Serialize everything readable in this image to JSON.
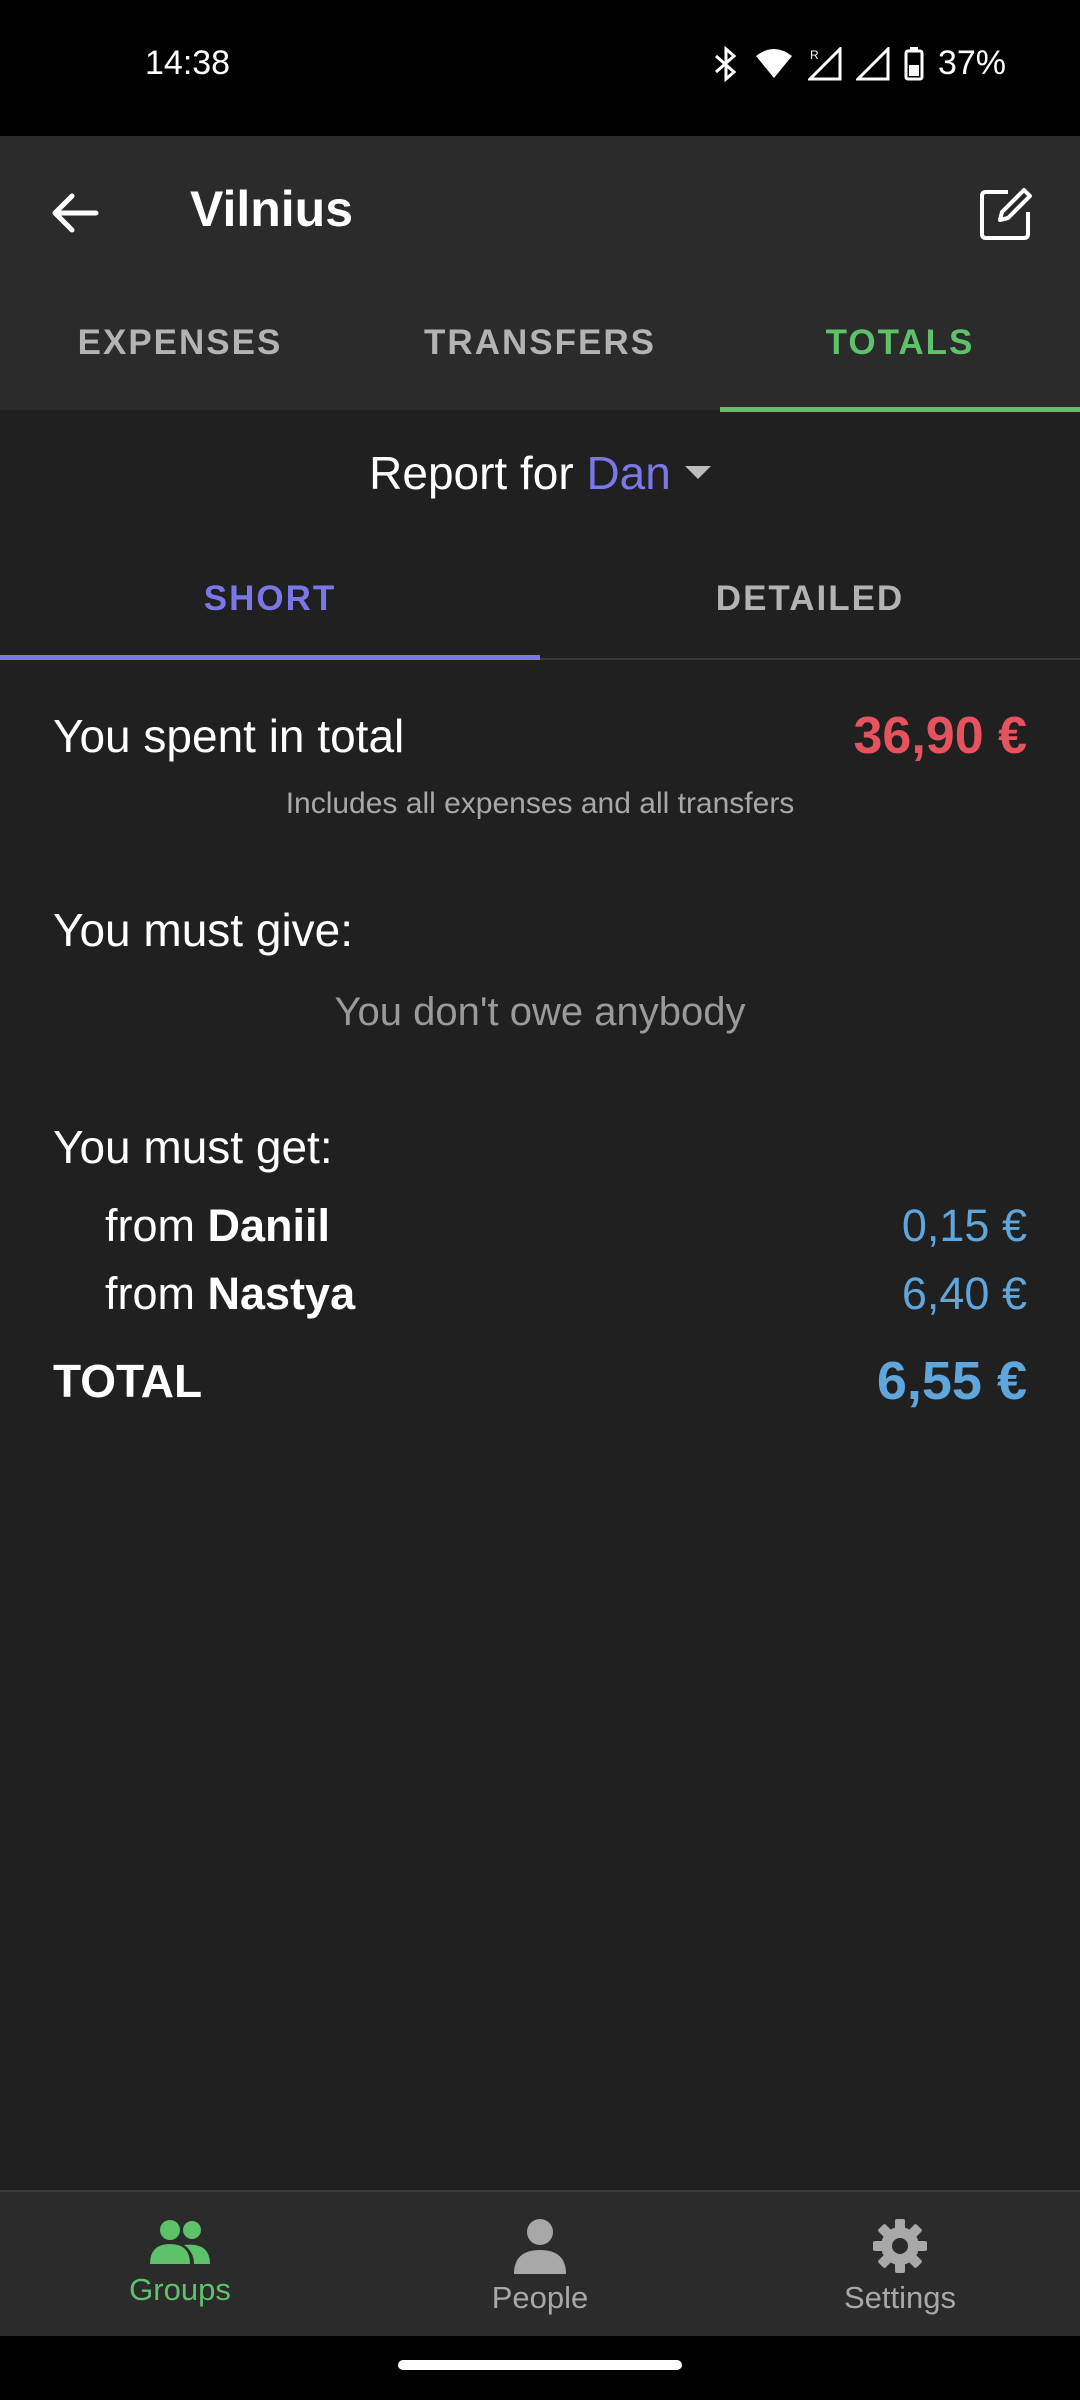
{
  "status_bar": {
    "time": "14:38",
    "battery": "37%"
  },
  "app_bar": {
    "title": "Vilnius"
  },
  "tabs": [
    {
      "label": "EXPENSES",
      "active": false
    },
    {
      "label": "TRANSFERS",
      "active": false
    },
    {
      "label": "TOTALS",
      "active": true
    }
  ],
  "report": {
    "prefix": "Report for",
    "person": "Dan"
  },
  "subtabs": [
    {
      "label": "SHORT",
      "active": true
    },
    {
      "label": "DETAILED",
      "active": false
    }
  ],
  "summary": {
    "spent_label": "You spent in total",
    "spent_value": "36,90 €",
    "spent_hint": "Includes all expenses and all transfers",
    "give_title": "You must give:",
    "give_empty": "You don't owe anybody",
    "get_title": "You must get:",
    "get_items": [
      {
        "prefix": "from",
        "name": "Daniil",
        "amount": "0,15 €"
      },
      {
        "prefix": "from",
        "name": "Nastya",
        "amount": "6,40 €"
      }
    ],
    "total_label": "TOTAL",
    "total_value": "6,55 €"
  },
  "bottom_nav": [
    {
      "label": "Groups",
      "icon": "groups-icon",
      "active": true
    },
    {
      "label": "People",
      "icon": "person-icon",
      "active": false
    },
    {
      "label": "Settings",
      "icon": "gear-icon",
      "active": false
    }
  ],
  "colors": {
    "green_accent": "#5ec26a",
    "purple_accent": "#7b77e8",
    "spent_red": "#e5545e",
    "amount_blue": "#5fa6dc"
  }
}
